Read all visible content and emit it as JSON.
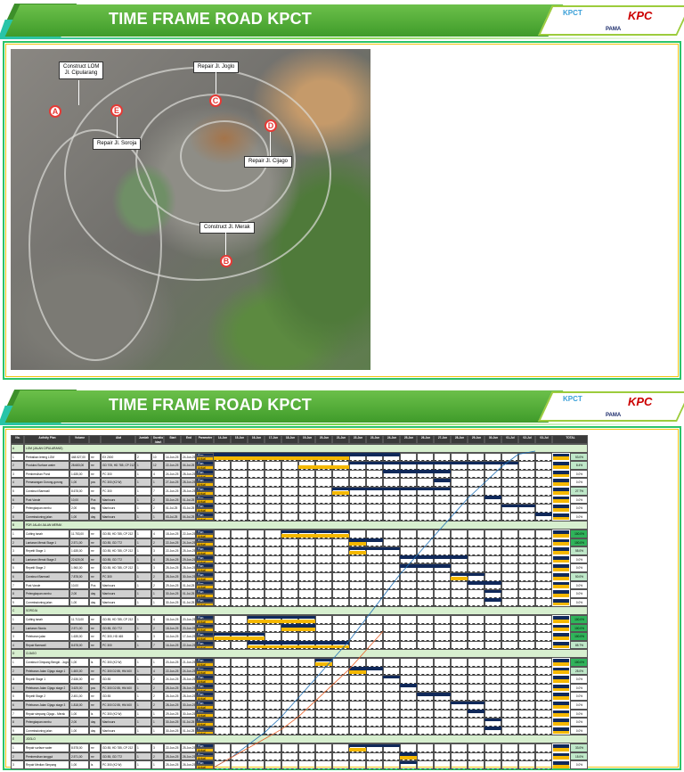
{
  "banner": {
    "title": "TIME FRAME ROAD KPCT",
    "logos": [
      "KPCT",
      "PAMA",
      "KPC"
    ]
  },
  "map": {
    "labels": [
      "Construct LOM\nJl. Cipularang",
      "Repair Jl. Joglo",
      "Repair Jl. Soroja",
      "Repair Jl. Cijago",
      "Construct Jl. Merak"
    ],
    "markers": [
      "A",
      "E",
      "C",
      "D",
      "B"
    ]
  },
  "table": {
    "headers": [
      "No.",
      "Activity Plan",
      "Volume",
      "",
      "Alat",
      "Jumlah",
      "Duration (day)",
      "Start",
      "End",
      "Parameter",
      "TOTAL"
    ],
    "dates": [
      "14-Jun",
      "15-Jun",
      "16-Jun",
      "17-Jun",
      "18-Jun",
      "19-Jun",
      "20-Jun",
      "21-Jun",
      "22-Jun",
      "23-Jun",
      "24-Jun",
      "25-Jun",
      "26-Jun",
      "27-Jun",
      "28-Jun",
      "29-Jun",
      "30-Jun",
      "01-Jul",
      "02-Jul",
      "03-Jul"
    ],
    "params": [
      "Plan",
      "Actual"
    ],
    "sections": [
      {
        "no": "A",
        "name": "LOM (JALAN CIPULARANG)",
        "rows": [
          [
            "1",
            "Perbaikan lereng LOM",
            "448.527,00",
            "m³",
            "EX 2000",
            "2",
            "10",
            "14-Jun-25",
            "24-Jun-25",
            "53.0%",
            [
              0,
              11
            ],
            [
              0,
              8
            ]
          ],
          [
            "2",
            "Produksi Surface water",
            "28.683,00",
            "m³",
            "GD 705, HD 785, CP 212",
            "1",
            "12",
            "22-Jun-25",
            "04-Jul-25",
            "8.4%",
            [
              8,
              18
            ],
            [
              5,
              8
            ]
          ],
          [
            "3",
            "Pembersihan Pond",
            "1.635,00",
            "m³",
            "PC 300",
            "1",
            "4",
            "24-Jun-25",
            "28-Jun-25",
            "0.0%",
            [
              10,
              14
            ],
            null
          ],
          [
            "4",
            "Pemasangan Gorong-gorong",
            "1,00",
            "pcs",
            "PC 300 (K2 W)",
            "1",
            "1",
            "27-Jun-25",
            "28-Jun-25",
            "0.0%",
            [
              13,
              14
            ],
            null
          ],
          [
            "5",
            "Construct Barewall",
            "8.678,00",
            "m³",
            "PC 300",
            "1",
            "7",
            "21-Jun-25",
            "28-Jun-25",
            "27.7%",
            [
              7,
              14
            ],
            [
              7,
              8
            ]
          ],
          [
            "6",
            "Post Vande",
            "10,00",
            "Pcs",
            "Manhours",
            "1",
            "2",
            "30-Jun-25",
            "01-Jul-25",
            "0.0%",
            [
              16,
              17
            ],
            null
          ],
          [
            "7",
            "Pelengkapan rambu",
            "2,00",
            "day",
            "Manhours",
            "1",
            "2",
            "01-Jul-25",
            "03-Jul-25",
            "0.0%",
            [
              17,
              19
            ],
            null
          ],
          [
            "8",
            "Commissioning jalan",
            "1,00",
            "day",
            "Manhours",
            "1",
            "1",
            "03-Jul-25",
            "04-Jul-25",
            "0.0%",
            [
              19,
              20
            ],
            null
          ]
        ]
      },
      {
        "no": "B",
        "name": "PDR JALAN JALAN MERAK",
        "rows": [
          [
            "1",
            "Cutting tanah",
            "11.753,00",
            "m³",
            "GD 85, HD 785, CP 212",
            "1",
            "4",
            "18-Jun-25",
            "22-Jun-25",
            "100.0%",
            [
              4,
              8
            ],
            [
              4,
              8
            ]
          ],
          [
            "2",
            "Lantaran Merak Stage 1",
            "2.571,00",
            "m³",
            "GD 85, GD 772",
            "1",
            "2",
            "22-Jun-25",
            "24-Jun-25",
            "100.0%",
            [
              8,
              10
            ],
            [
              8,
              9
            ]
          ],
          [
            "3",
            "Repetit Stage 1",
            "1.635,00",
            "m³",
            "GD 85, HD 785, CP 212",
            "1",
            "3",
            "22-Jun-25",
            "25-Jun-25",
            "55.0%",
            [
              8,
              11
            ],
            [
              8,
              9
            ]
          ],
          [
            "4",
            "Lantaran Merak Stage 2",
            "22.620,00",
            "m³",
            "GD 85, GD 772",
            "1",
            "4",
            "25-Jun-25",
            "29-Jun-25",
            "0.0%",
            [
              11,
              15
            ],
            null
          ],
          [
            "5",
            "Repetit Stage 2",
            "1.960,00",
            "m³",
            "GD 85, HD 785, CP 212",
            "1",
            "3",
            "25-Jun-25",
            "28-Jun-25",
            "0.0%",
            [
              11,
              14
            ],
            null
          ],
          [
            "6",
            "Construct Barewall",
            "7.878,00",
            "m³",
            "PC 300",
            "1",
            "2",
            "28-Jun-25",
            "30-Jun-25",
            "50.0%",
            [
              14,
              16
            ],
            [
              14,
              15
            ]
          ],
          [
            "7",
            "Post Vande",
            "10,00",
            "Pcs",
            "Manhours",
            "1",
            "2",
            "29-Jun-25",
            "01-Jul-25",
            "0.0%",
            [
              15,
              17
            ],
            null
          ],
          [
            "8",
            "Pelengkapan rambu",
            "2,00",
            "day",
            "Manhours",
            "1",
            "1",
            "30-Jun-25",
            "01-Jul-25",
            "0.0%",
            [
              16,
              17
            ],
            null
          ],
          [
            "9",
            "Commissioning jalan",
            "1,00",
            "day",
            "Manhours",
            "1",
            "1",
            "30-Jun-25",
            "01-Jul-25",
            "0.0%",
            [
              16,
              17
            ],
            null
          ]
        ]
      },
      {
        "no": "C",
        "name": "SOROJA",
        "rows": [
          [
            "1",
            "Cutting tanah",
            "11.713,00",
            "m³",
            "GD 85, HD 785, CP 212",
            "1",
            "4",
            "16-Jun-25",
            "20-Jun-25",
            "100.0%",
            [
              2,
              6
            ],
            [
              2,
              6
            ]
          ],
          [
            "2",
            "Lantaran Stonia",
            "2.571,00",
            "m³",
            "GD 85, GD 772",
            "1",
            "2",
            "18-Jun-25",
            "20-Jun-25",
            "100.0%",
            [
              4,
              6
            ],
            [
              4,
              6
            ]
          ],
          [
            "3",
            "Pelebaran jalan",
            "1.635,00",
            "m³",
            "PC 300, HD 465",
            "1",
            "3",
            "14-Jun-25",
            "17-Jun-25",
            "100.0%",
            [
              0,
              3
            ],
            [
              0,
              3
            ]
          ],
          [
            "4",
            "Repair Barewall",
            "8.678,00",
            "m³",
            "PC 300",
            "1",
            "7",
            "16-Jun-25",
            "22-Jun-25",
            "85.7%",
            [
              2,
              8
            ],
            [
              2,
              8
            ]
          ]
        ]
      },
      {
        "no": "D",
        "name": "CIJAGO",
        "rows": [
          [
            "1",
            "Construct Gimpang Bengki - Joglo",
            "1,00",
            "ls",
            "PC 300 (K2 W)",
            "1",
            "1",
            "20-Jun-25",
            "21-Jun-25",
            "100.0%",
            [
              6,
              7
            ],
            [
              6,
              7
            ]
          ],
          [
            "2",
            "Pelebaran Jalan Cijago stage 1",
            "1.600,00",
            "m³",
            "PC 300 D2 85, HM 400",
            "1",
            "4",
            "22-Jun-25",
            "24-Jun-25",
            "25.0%",
            [
              8,
              10
            ],
            [
              8,
              9
            ]
          ],
          [
            "3",
            "Repetit Stage 1",
            "2.636,00",
            "m³",
            "GD 85",
            "1",
            "2",
            "24-Jun-25",
            "25-Jun-25",
            "0.0%",
            [
              10,
              11
            ],
            null
          ],
          [
            "4",
            "Pelebaran Jalan Cijago stage 2",
            "3.625,00",
            "pcs",
            "PC 300 D2 85, HM 400",
            "1",
            "2",
            "25-Jun-25",
            "26-Jun-25",
            "0.0%",
            [
              11,
              12
            ],
            null
          ],
          [
            "5",
            "Repetit Stage 2",
            "2.451,00",
            "m³",
            "GD 85",
            "1",
            "2",
            "26-Jun-25",
            "28-Jun-25",
            "0.0%",
            [
              12,
              14
            ],
            null
          ],
          [
            "6",
            "Pelebaran Jalan Cijago stage 3",
            "1.818,00",
            "m³",
            "PC 300 D2 85, HM 400",
            "1",
            "2",
            "28-Jun-25",
            "30-Jun-25",
            "0.0%",
            [
              14,
              16
            ],
            null
          ],
          [
            "7",
            "Repair simpang Cijago - Merak",
            "1,00",
            "ls",
            "PC 300 (K2 W)",
            "1",
            "1",
            "29-Jun-25",
            "30-Jun-25",
            "0.0%",
            [
              15,
              16
            ],
            null
          ],
          [
            "8",
            "Pelengkapan rambu",
            "2,00",
            "day",
            "Manhours",
            "1",
            "1",
            "30-Jun-25",
            "01-Jul-25",
            "0.0%",
            [
              16,
              17
            ],
            null
          ],
          [
            "9",
            "Commissioning jalan",
            "1,00",
            "day",
            "Manhours",
            "1",
            "1",
            "30-Jun-25",
            "01-Jul-25",
            "0.0%",
            [
              16,
              17
            ],
            null
          ]
        ]
      },
      {
        "no": "E",
        "name": "JOGLO",
        "rows": [
          [
            "1",
            "Repair surface water",
            "8.578,00",
            "m³",
            "GD 85, HD 785, CP 212",
            "1",
            "3",
            "22-Jun-25",
            "25-Jun-25",
            "33.0%",
            [
              8,
              11
            ],
            [
              8,
              9
            ]
          ],
          [
            "2",
            "Pembersihan tanggul",
            "2.571,00",
            "m³",
            "GD 85, GD 772",
            "1",
            "2",
            "25-Jun-25",
            "26-Jun-25",
            "15.0%",
            [
              11,
              12
            ],
            [
              11,
              12
            ]
          ],
          [
            "3",
            "Repair Median Simpang",
            "1,00",
            "ls",
            "PC 300 (K2 W)",
            "1",
            "1",
            "25-Jun-25",
            "26-Jun-25",
            "0.0%",
            [
              11,
              12
            ],
            null
          ]
        ]
      }
    ]
  },
  "s_curve": {
    "plan": [
      0,
      3,
      7,
      11,
      16,
      22,
      28,
      34,
      40,
      47,
      54,
      61,
      67,
      73,
      79,
      85,
      90,
      95,
      99,
      100
    ],
    "actual": [
      0,
      3,
      6,
      9,
      12,
      16,
      21,
      26,
      31,
      37,
      43
    ]
  },
  "colors": {
    "plan": "#10295a",
    "actual": "#f5b800",
    "total_full": "#2fb35a",
    "total_part": "#bfe8c9"
  }
}
